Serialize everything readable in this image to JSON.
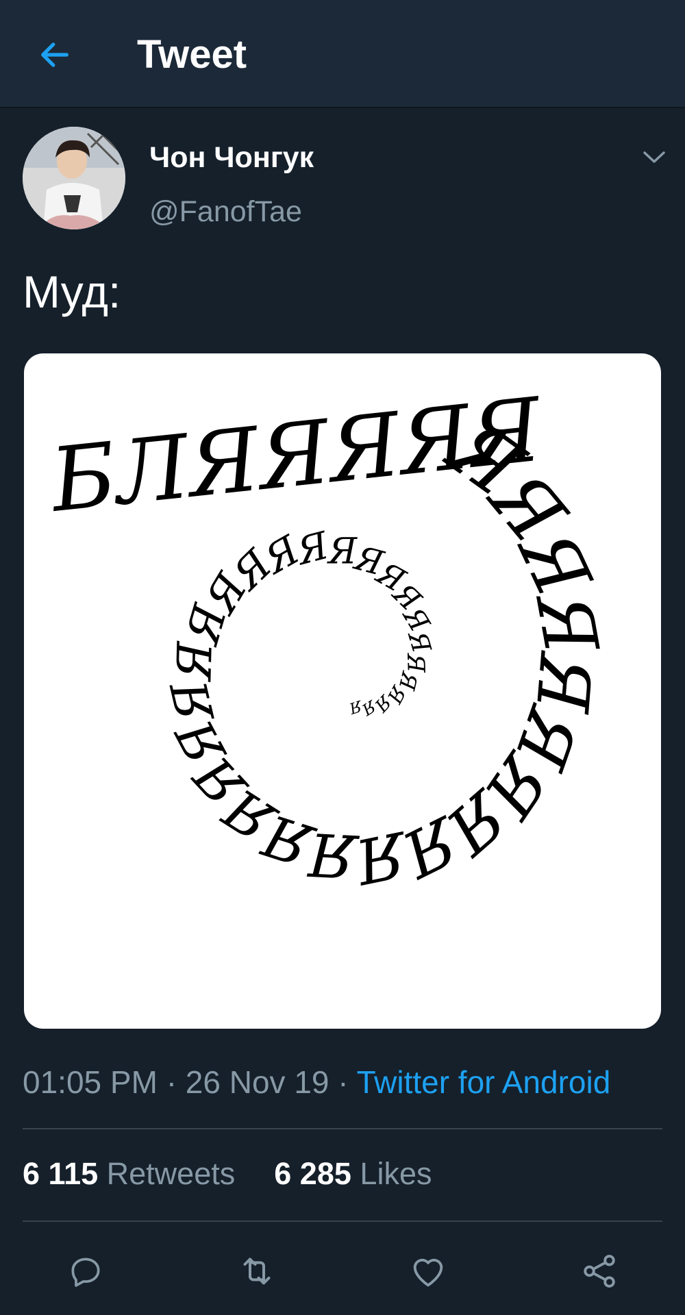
{
  "header": {
    "title": "Tweet"
  },
  "tweet": {
    "display_name": "Чон Чонгук",
    "handle": "@FanofTae",
    "text": "Муд:",
    "time": "01:05 PM",
    "date": "26 Nov 19",
    "source": "Twitter for Android",
    "retweets_count": "6 115",
    "retweets_label": "Retweets",
    "likes_count": "6 285",
    "likes_label": "Likes"
  },
  "image": {
    "first_word": "БЛЯЯЯЯЯ",
    "spiral_letter": "Я"
  },
  "icons": {
    "back": "arrow-left-icon",
    "caret": "chevron-down-icon",
    "reply": "reply-icon",
    "retweet": "retweet-icon",
    "like": "heart-icon",
    "share": "share-icon"
  },
  "colors": {
    "background": "#15202b",
    "header": "#1c2938",
    "accent": "#1da1f2",
    "secondary_text": "#8899a6",
    "divider": "#38444d"
  }
}
